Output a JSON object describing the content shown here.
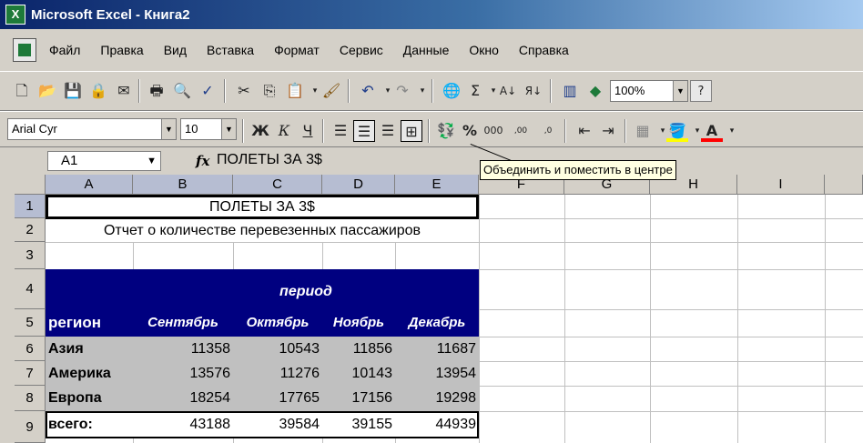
{
  "window": {
    "title": "Microsoft Excel - Книга2",
    "icon_text": "X"
  },
  "menu": [
    "Файл",
    "Правка",
    "Вид",
    "Вставка",
    "Формат",
    "Сервис",
    "Данные",
    "Окно",
    "Справка"
  ],
  "toolbar1": {
    "zoom": "100%",
    "help": "?"
  },
  "toolbar2": {
    "font": "Arial Cyr",
    "size": "10",
    "bold": "Ж",
    "italic": "К",
    "underline": "Ч",
    "percent": "%",
    "thousands": "000",
    "inc_decimal": ",00 →,0",
    "dec_decimal": ",0 →,00",
    "underline_color": "#ff0000",
    "fill_color": "#ffff00"
  },
  "formula_bar": {
    "name_box": "A1",
    "fx": "fx",
    "content": "ПОЛЕТЫ ЗА 3$"
  },
  "tooltip": "Объединить и поместить в центре",
  "columns": [
    "A",
    "B",
    "C",
    "D",
    "E",
    "F",
    "G",
    "H",
    "I"
  ],
  "rows": [
    "1",
    "2",
    "3",
    "4",
    "5",
    "6",
    "7",
    "8",
    "9"
  ],
  "sheet": {
    "title": "ПОЛЕТЫ ЗА 3$",
    "subtitle": "Отчет о количестве перевезенных пассажиров",
    "period": "период",
    "region_header": "регион",
    "months": [
      "Сентябрь",
      "Октябрь",
      "Ноябрь",
      "Декабрь"
    ],
    "data": [
      {
        "region": "Азия",
        "values": [
          "11358",
          "10543",
          "11856",
          "11687"
        ]
      },
      {
        "region": "Америка",
        "values": [
          "13576",
          "11276",
          "10143",
          "13954"
        ]
      },
      {
        "region": "Европа",
        "values": [
          "18254",
          "17765",
          "17156",
          "19298"
        ]
      }
    ],
    "total_label": "всего:",
    "totals": [
      "43188",
      "39584",
      "39155",
      "44939"
    ],
    "header_bg": "#000080",
    "data_bg": "#c0c0c0"
  }
}
